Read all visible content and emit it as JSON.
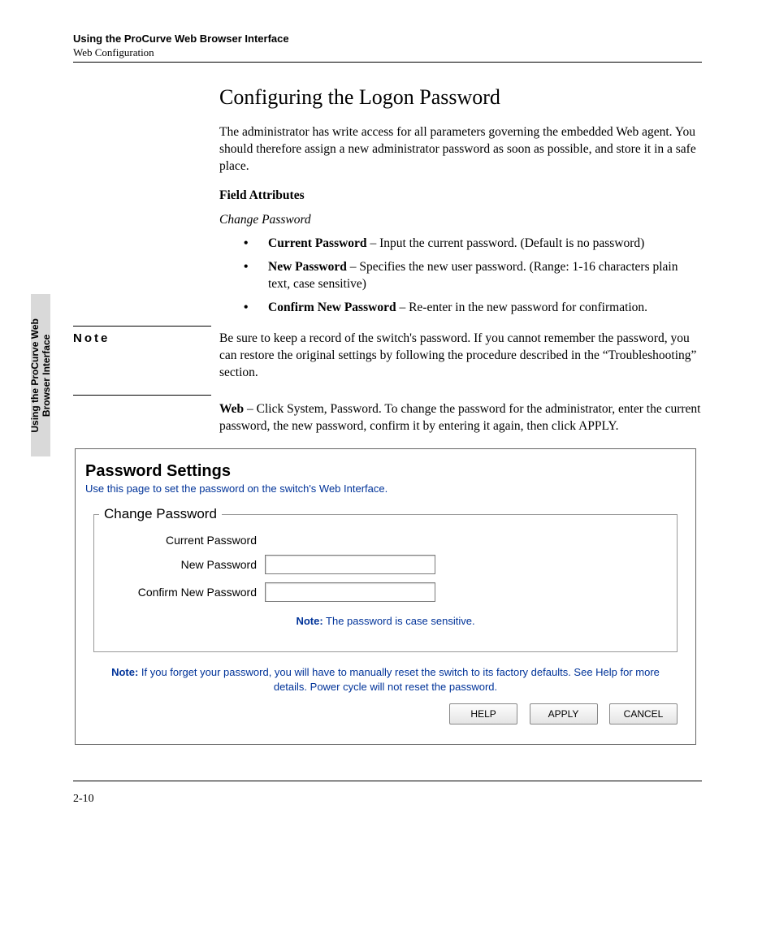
{
  "header": {
    "title": "Using the ProCurve Web Browser Interface",
    "subtitle": "Web Configuration"
  },
  "sidetab": {
    "line1": "Using the ProCurve Web",
    "line2": "Browser Interface"
  },
  "section": {
    "heading": "Configuring the Logon Password",
    "intro": "The administrator has write access for all parameters governing the embedded Web agent. You should therefore assign a new administrator password as soon as possible, and store it in a safe place.",
    "field_attributes_label": "Field Attributes",
    "change_password_label": "Change Password",
    "bullets": {
      "b1_strong": "Current Password",
      "b1_rest": " – Input the current password. (Default is no password)",
      "b2_strong": "New Password",
      "b2_rest": " – Specifies the new user password. (Range: 1-16 characters plain text, case sensitive)",
      "b3_strong": "Confirm New Password",
      "b3_rest": " – Re-enter in the new password for confirmation."
    },
    "note_label": "Note",
    "note_body": "Be sure to keep a record of the switch's password. If you cannot remember the password, you can restore the original settings by following the procedure described in the “Troubleshooting” section.",
    "web_strong": "Web",
    "web_rest": " – Click System, Password. To change the password for the administrator, enter the current password, the new password, confirm it by entering it again, then click APPLY."
  },
  "ui": {
    "title": "Password Settings",
    "subtitle": "Use this page to set the password on the switch's Web Interface.",
    "legend": "Change Password",
    "rows": {
      "current": "Current Password",
      "newp": "New Password",
      "confirm": "Confirm New Password"
    },
    "note_center_strong": "Note:",
    "note_center_rest": " The password is case sensitive.",
    "note_bottom_strong": "Note:",
    "note_bottom_rest": " If you forget your password, you will have to manually reset the switch to its factory defaults. See Help for more details. Power cycle will not reset the password.",
    "buttons": {
      "help": "HELP",
      "apply": "APPLY",
      "cancel": "CANCEL"
    }
  },
  "footer": {
    "page": "2-10"
  }
}
